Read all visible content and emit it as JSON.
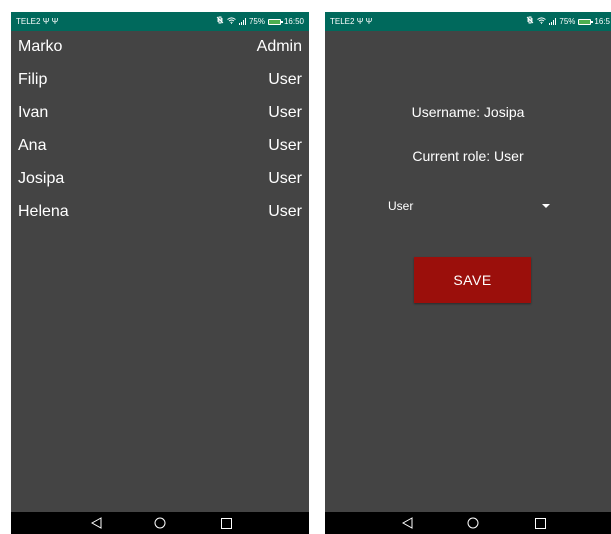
{
  "colors": {
    "status_bar": "#00695c",
    "screen_background": "#444444",
    "nav_bar": "#000000",
    "save_button": "#9b0f0b",
    "text": "#ffffff"
  },
  "left_screen": {
    "status_bar": {
      "carrier": "TELE2",
      "usb_icons": "Ψ Ψ",
      "icons": [
        "vibrate-off-icon",
        "wifi-icon",
        "signal-icon",
        "battery-icon"
      ],
      "battery_percent": "75%",
      "time": "16:50"
    },
    "users": [
      {
        "name": "Marko",
        "role": "Admin"
      },
      {
        "name": "Filip",
        "role": "User"
      },
      {
        "name": "Ivan",
        "role": "User"
      },
      {
        "name": "Ana",
        "role": "User"
      },
      {
        "name": "Josipa",
        "role": "User"
      },
      {
        "name": "Helena",
        "role": "User"
      }
    ]
  },
  "right_screen": {
    "status_bar": {
      "carrier": "TELE2",
      "usb_icons": "Ψ Ψ",
      "icons": [
        "vibrate-off-icon",
        "wifi-icon",
        "signal-icon",
        "battery-icon"
      ],
      "battery_percent": "75%",
      "time": "16:5"
    },
    "username_label": "Username: Josipa",
    "current_role_label": "Current role: User",
    "role_select": {
      "selected": "User"
    },
    "save_label": "SAVE"
  },
  "nav_bar": {
    "icons": [
      "back-icon",
      "home-icon",
      "recents-icon"
    ]
  }
}
